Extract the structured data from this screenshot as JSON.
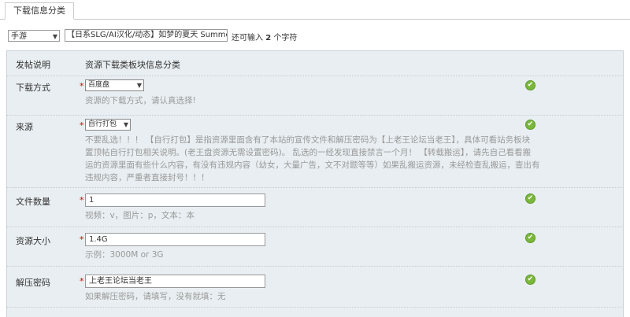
{
  "tabs": [
    {
      "label": "下载信息分类"
    }
  ],
  "title_bar": {
    "type_select": "手游",
    "title_value": "【日系SLG/AI汉化/动态】如梦的夏天 Summer like a Dre",
    "hint_prefix": "还可输入",
    "hint_count": "2",
    "hint_suffix": "个字符"
  },
  "form": {
    "header": {
      "label": "发帖说明",
      "value": "资源下载类板块信息分类"
    },
    "rows": [
      {
        "label": "下载方式",
        "value": "百度盘",
        "help": "资源的下载方式，请认真选择!"
      },
      {
        "label": "来源",
        "value": "自行打包",
        "help_lines": [
          "不要乱选！！！  【自行打包】是指资源里面含有了本站的宣传文件和解压密码为【上老王论坛当老王】，具体可看站务板块",
          "置顶帖自行打包相关说明。(老王盘资源无需设置密码)。 乱选的一经发现直接禁言一个月！ 【转载搬运】，请先自己看看搬",
          "运的资源里面有些什么内容，有没有违规内容（幼女，大量广告，文不对题等等）如果乱搬运资源，未经检查乱搬运，查出有",
          "违规内容，严重者直接封号！！！"
        ]
      },
      {
        "label": "文件数量",
        "value": "1",
        "help": "视频：v，图片：p，文本：本"
      },
      {
        "label": "资源大小",
        "value": "1.4G",
        "help": "示例：3000M or 3G"
      },
      {
        "label": "解压密码",
        "value": "上老王论坛当老王",
        "help": "如果解压密码，请填写，没有就填：无"
      }
    ],
    "required_mark": "*",
    "check_icon": "check-circle-icon",
    "check_glyph": "✔"
  },
  "colors": {
    "panel_bg": "#e8eef2",
    "check_green": "#7ab83b",
    "required_red": "#d40000",
    "help_gray": "#999999"
  }
}
